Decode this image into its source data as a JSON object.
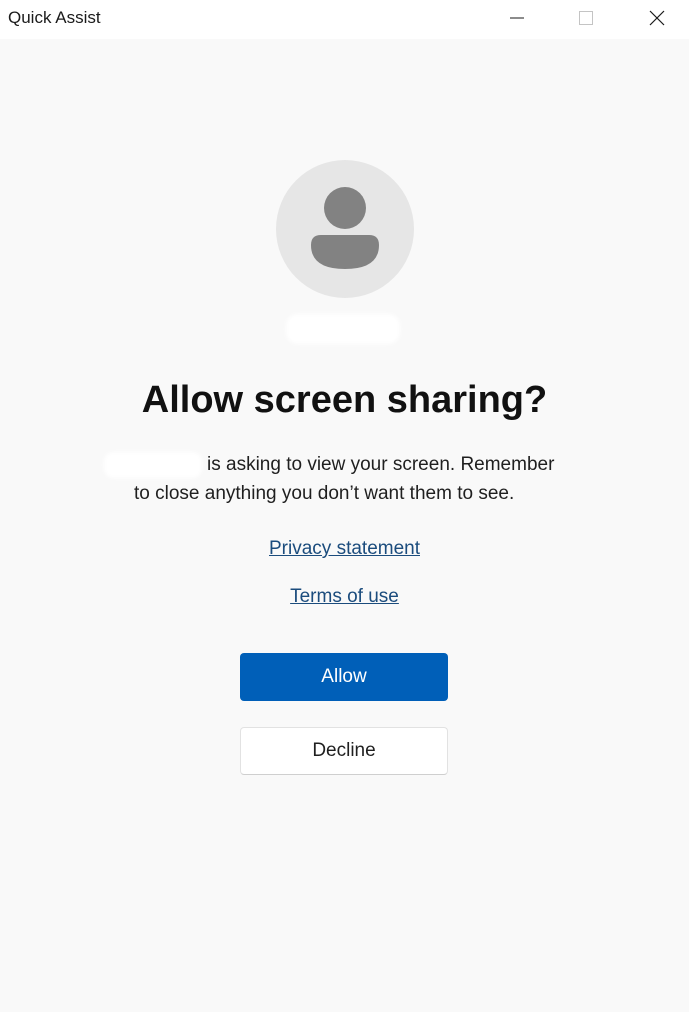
{
  "window": {
    "title": "Quick Assist",
    "controls": {
      "minimize": "minimize-icon",
      "maximize": "maximize-icon",
      "close": "close-icon"
    }
  },
  "dialog": {
    "heading": "Allow screen sharing?",
    "message_line1": "is asking to view your screen. Remember",
    "message_line2": "to close anything you don’t want them to see.",
    "privacy_link": "Privacy statement",
    "terms_link": "Terms of use",
    "allow_label": "Allow",
    "decline_label": "Decline"
  },
  "colors": {
    "accent": "#005fb8",
    "link": "#1b4c7d",
    "background": "#f9f9f9"
  }
}
